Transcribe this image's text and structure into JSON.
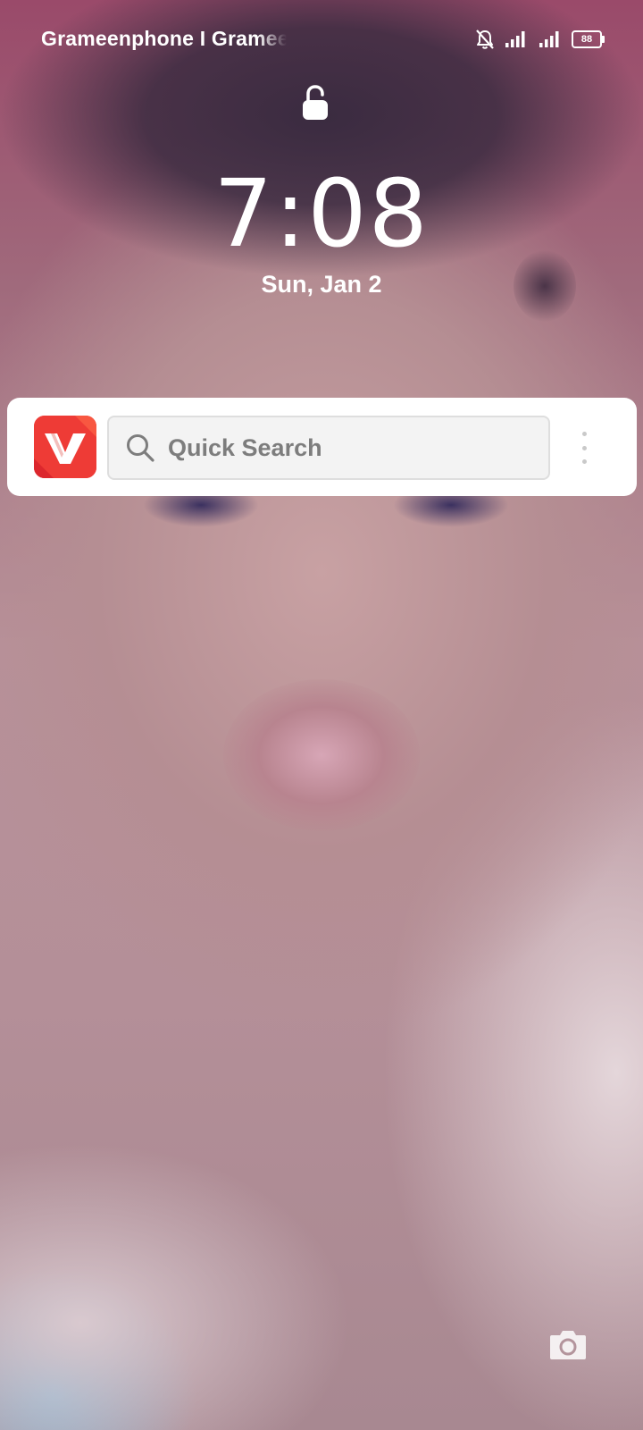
{
  "status_bar": {
    "carrier": "Grameenphone I Grameenphone",
    "battery_level": "88"
  },
  "lockscreen": {
    "time": "7:08",
    "date": "Sun, Jan 2"
  },
  "search_widget": {
    "placeholder": "Quick Search",
    "app_icon": "vidmate-logo"
  },
  "icons": {
    "lock": "lock-icon",
    "camera": "camera-icon",
    "search": "search-icon",
    "more": "more-vertical-icon",
    "mute": "bell-off-icon",
    "signal": "signal-icon"
  },
  "colors": {
    "widget_bg": "#ffffff",
    "search_bg": "#f3f3f3",
    "app_red": "#e8222e"
  }
}
